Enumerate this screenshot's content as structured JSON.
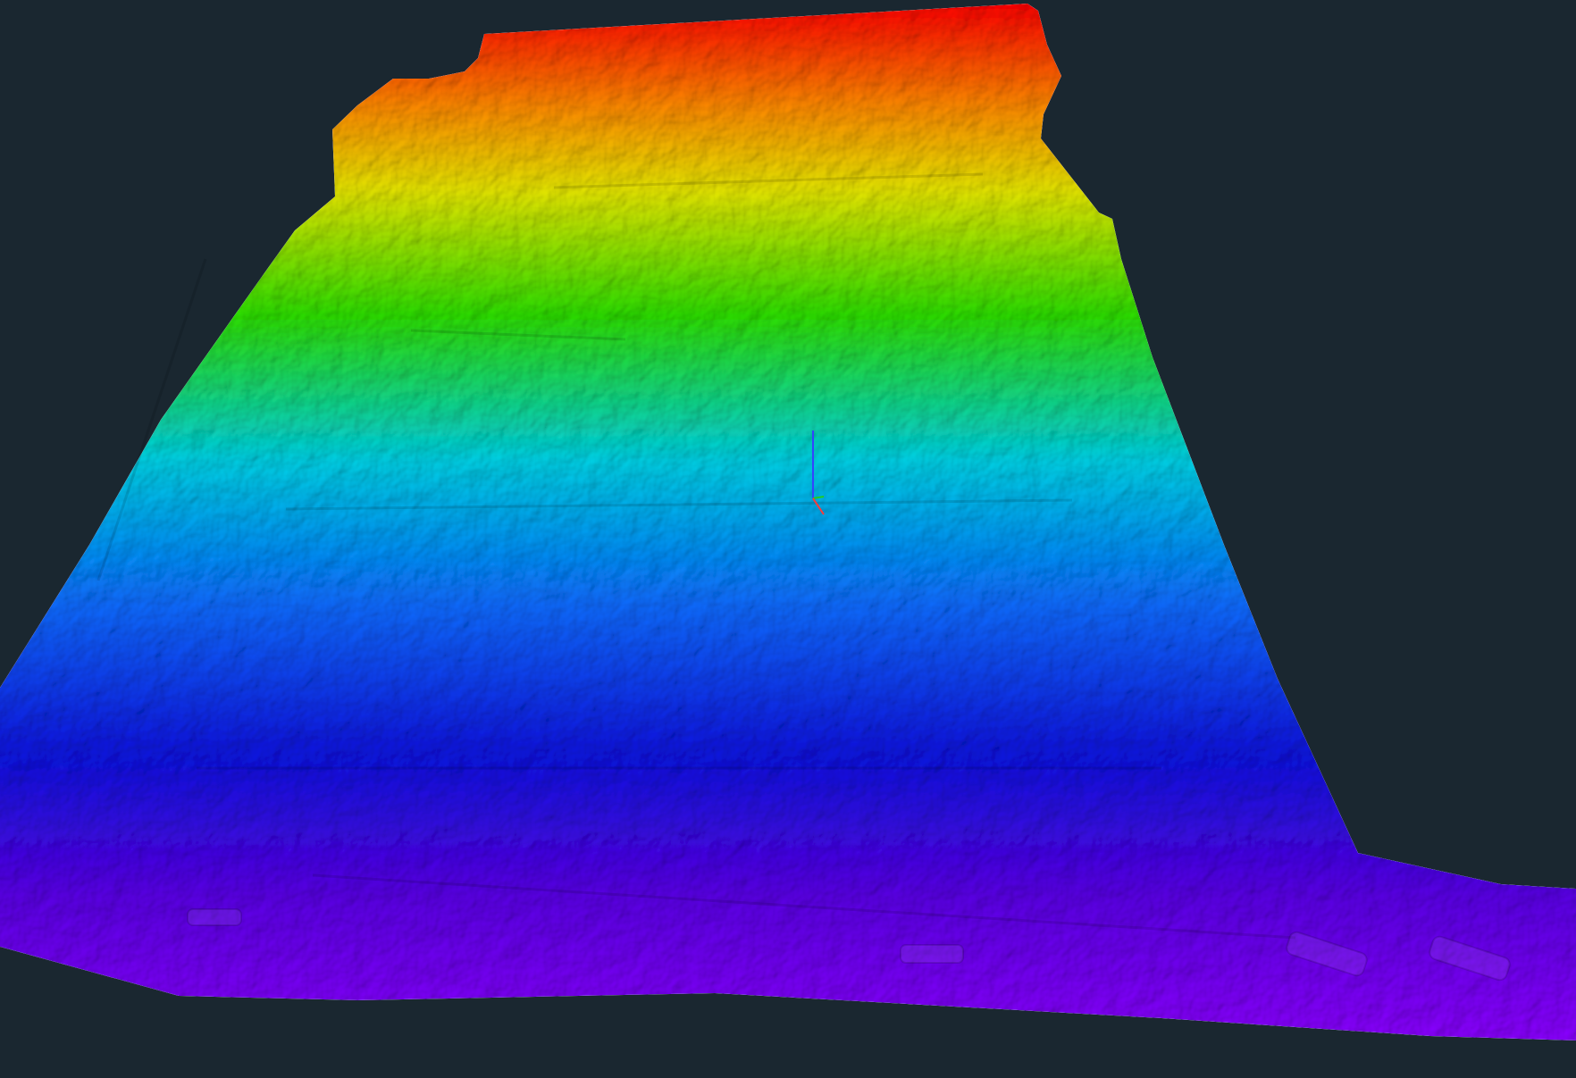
{
  "viewport": {
    "background": "#1a2730"
  },
  "heightmap": {
    "color_ramp": [
      "#ff0000",
      "#ff8c00",
      "#e8e800",
      "#2ee000",
      "#00d2e6",
      "#0a6bff",
      "#0a16e0",
      "#5a00e6",
      "#8a00ff"
    ]
  },
  "axis_gizmo": {
    "icon": "xyz-axes-icon",
    "x_color": "#ff3a3a",
    "y_color": "#22cc22",
    "z_color": "#3344ff"
  }
}
